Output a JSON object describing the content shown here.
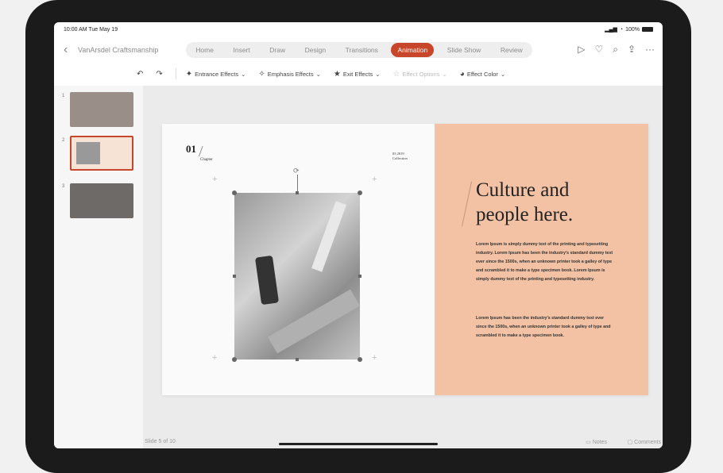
{
  "status": {
    "time": "10:00 AM  Tue May 19",
    "battery": "100%"
  },
  "document": {
    "title": "VanArsdel Craftsmanship"
  },
  "tabs": [
    {
      "label": "Home",
      "active": false
    },
    {
      "label": "Insert",
      "active": false
    },
    {
      "label": "Draw",
      "active": false
    },
    {
      "label": "Design",
      "active": false
    },
    {
      "label": "Transitions",
      "active": false
    },
    {
      "label": "Animation",
      "active": true
    },
    {
      "label": "Slide Show",
      "active": false
    },
    {
      "label": "Review",
      "active": false
    }
  ],
  "ribbon": {
    "entrance": "Entrance Effects",
    "emphasis": "Emphasis Effects",
    "exit": "Exit Effects",
    "options": "Effect Options",
    "color": "Effect Color"
  },
  "thumbnails": [
    {
      "num": "1",
      "bg": "#9a8f88"
    },
    {
      "num": "2",
      "bg": "#f6e3d6"
    },
    {
      "num": "3",
      "bg": "#6d6a68"
    }
  ],
  "slide": {
    "chapter_num": "01",
    "chapter_label": "Chapter",
    "date_line1": "03 2019",
    "date_line2": "Collection",
    "heading_line1": "Culture and",
    "heading_line2": "people here.",
    "para1": "Lorem Ipsum is simply dummy text of the printing and typesetting industry. Lorem Ipsum has been the industry's standard dummy text ever since the 1500s, when an unknown printer took a galley of type and scrambled it to make a type specimen book. Lorem Ipsum is simply dummy text of the printing and typesetting industry.",
    "para2": "Lorem Ipsum has been the industry's standard dummy text ever since the 1500s, when an unknown printer took a galley of type and scrambled it to make a type specimen book."
  },
  "footer": {
    "slide_indicator": "Slide 5 of 10",
    "notes": "Notes",
    "comments": "Comments"
  },
  "colors": {
    "accent": "#c8472a",
    "slide_panel": "#f3c2a4"
  }
}
